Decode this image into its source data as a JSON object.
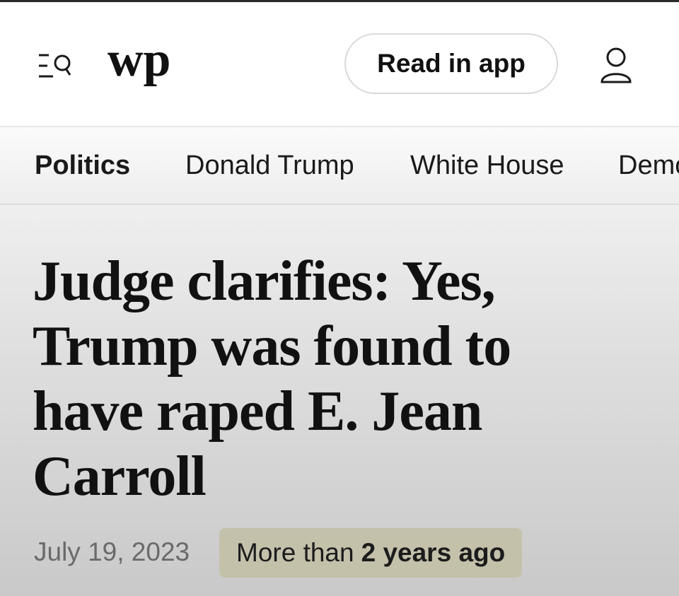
{
  "header": {
    "logo_text": "wp",
    "read_in_app_label": "Read in app",
    "icons": {
      "menu": "menu-search-icon",
      "account": "user-icon"
    }
  },
  "nav": {
    "items": [
      {
        "label": "Politics",
        "active": true
      },
      {
        "label": "Donald Trump",
        "active": false
      },
      {
        "label": "White House",
        "active": false
      },
      {
        "label": "Demo",
        "active": false
      }
    ]
  },
  "article": {
    "headline": "Judge clarifies: Yes, Trump was found to have raped E. Jean Carroll",
    "date": "July 19, 2023",
    "age_prefix": "More than",
    "age_emphasis": "2 years ago"
  },
  "colors": {
    "badge_background": "#c4c1ab",
    "nav_background": "#f3f3f3",
    "text": "#111111",
    "date_text": "#6a6a6a"
  }
}
